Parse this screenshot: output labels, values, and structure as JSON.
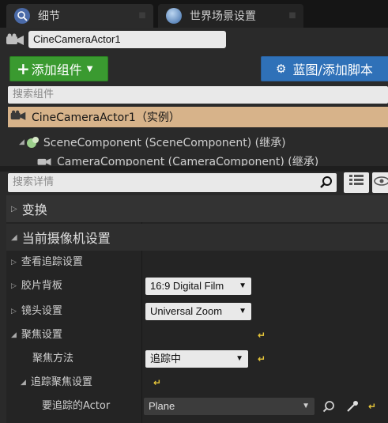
{
  "tabs": [
    {
      "label": "细节",
      "icon": "details-icon"
    },
    {
      "label": "世界场景设置",
      "icon": "world-globe-icon"
    }
  ],
  "actor": {
    "name": "CineCameraActor1",
    "icon": "camera-actor-icon"
  },
  "toolbar": {
    "add_component_label": "添加组件",
    "blueprint_label": "蓝图/添加脚本"
  },
  "component_search": {
    "placeholder": "搜索组件"
  },
  "components": {
    "root_label": "CineCameraActor1（实例）",
    "items": [
      {
        "label": "SceneComponent (SceneComponent) (继承)"
      },
      {
        "label": "CameraComponent (CameraComponent) (继承)"
      }
    ]
  },
  "details_search": {
    "placeholder": "搜索详情"
  },
  "categories": [
    {
      "label": "变换",
      "expanded": false
    },
    {
      "label": "当前摄像机设置",
      "expanded": true
    }
  ],
  "properties": {
    "lookat_tracking": {
      "label": "查看追踪设置"
    },
    "filmback": {
      "label": "胶片背板",
      "value": "16:9 Digital Film"
    },
    "lens": {
      "label": "镜头设置",
      "value": "Universal Zoom"
    },
    "focus": {
      "label": "聚焦设置"
    },
    "focus_method": {
      "label": "聚焦方法",
      "value": "追踪中"
    },
    "tracking_focus": {
      "label": "追踪聚焦设置"
    },
    "actor_to_track": {
      "label": "要追踪的Actor",
      "value": "Plane"
    }
  },
  "colors": {
    "add_button": "#3a9a30",
    "blueprint_button": "#2f71b8",
    "component_header": "#d7b38a",
    "reset_arrow": "#e8c73a"
  }
}
